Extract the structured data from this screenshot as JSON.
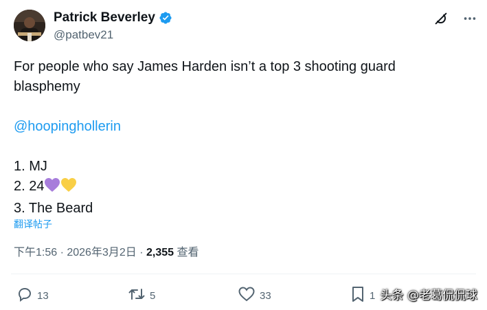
{
  "author": {
    "name": "Patrick Beverley",
    "handle": "@patbev21"
  },
  "tweet": {
    "lines": [
      "For people who say James Harden isn’t a top 3 shooting guard",
      "blasphemy"
    ],
    "mention": "@hoopinghollerin",
    "list": [
      "1. MJ",
      "2. 24",
      "3. The Beard"
    ]
  },
  "translate_label": "翻译帖子",
  "meta": {
    "time": "下午1:56 · 2026年3月2日 · ",
    "views": "2,355",
    "views_label": " 查看"
  },
  "actions": {
    "replies": "13",
    "reposts": "5",
    "likes": "33",
    "bookmarks": "1"
  },
  "watermark": "头条 @老葛侃侃球",
  "colors": {
    "accent": "#1d9bf0",
    "muted": "#536471",
    "purple_heart": "#a77ddb",
    "yellow_heart": "#f9cf46"
  }
}
